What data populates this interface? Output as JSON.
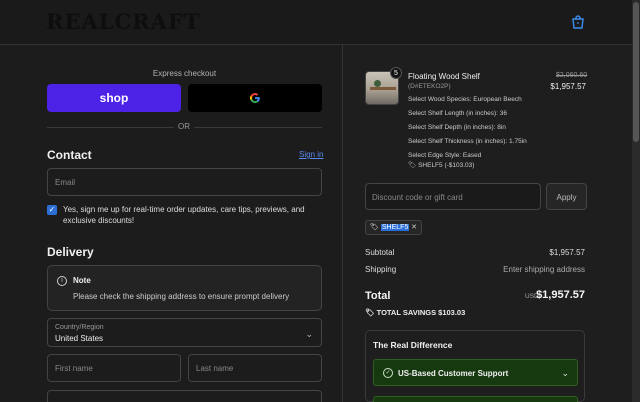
{
  "header": {
    "logo": "REALCRAFT",
    "bag_icon": "shopping-bag-icon"
  },
  "express": {
    "title": "Express checkout",
    "shop_label": "shop",
    "google_label": "G",
    "or": "OR"
  },
  "contact": {
    "title": "Contact",
    "signin": "Sign in",
    "email_placeholder": "Email",
    "checkbox_checked": true,
    "checkbox_label": "Yes, sign me up for real-time order updates, care tips, previews, and exclusive discounts!"
  },
  "delivery": {
    "title": "Delivery",
    "note_title": "Note",
    "note_text": "Please check the shipping address to ensure prompt delivery",
    "country_label": "Country/Region",
    "country_value": "United States",
    "first_name_placeholder": "First name",
    "last_name_placeholder": "Last name"
  },
  "order": {
    "product": {
      "quantity": "5",
      "name": "Floating Wood Shelf",
      "sku": "(D#ETEKO2P)",
      "options": [
        "Select Wood Species: European Beech",
        "Select Shelf Length (in inches): 36",
        "Select Shelf Depth (in inches): 8in",
        "Select Shelf Thickness (in inches): 1.75in",
        "Select Edge Style: Eased"
      ],
      "discount_line": "SHELF5 (-$103.03)",
      "old_price": "$2,060.60",
      "price": "$1,957.57"
    },
    "discount_placeholder": "Discount code or gift card",
    "apply_label": "Apply",
    "applied_code": "SHELF5",
    "subtotal_label": "Subtotal",
    "subtotal_value": "$1,957.57",
    "shipping_label": "Shipping",
    "shipping_value": "Enter shipping address",
    "total_label": "Total",
    "total_currency": "USD",
    "total_value": "$1,957.57",
    "savings": "TOTAL SAVINGS $103.03",
    "difference": {
      "title": "The Real Difference",
      "items": [
        "US-Based Customer Support"
      ]
    }
  }
}
